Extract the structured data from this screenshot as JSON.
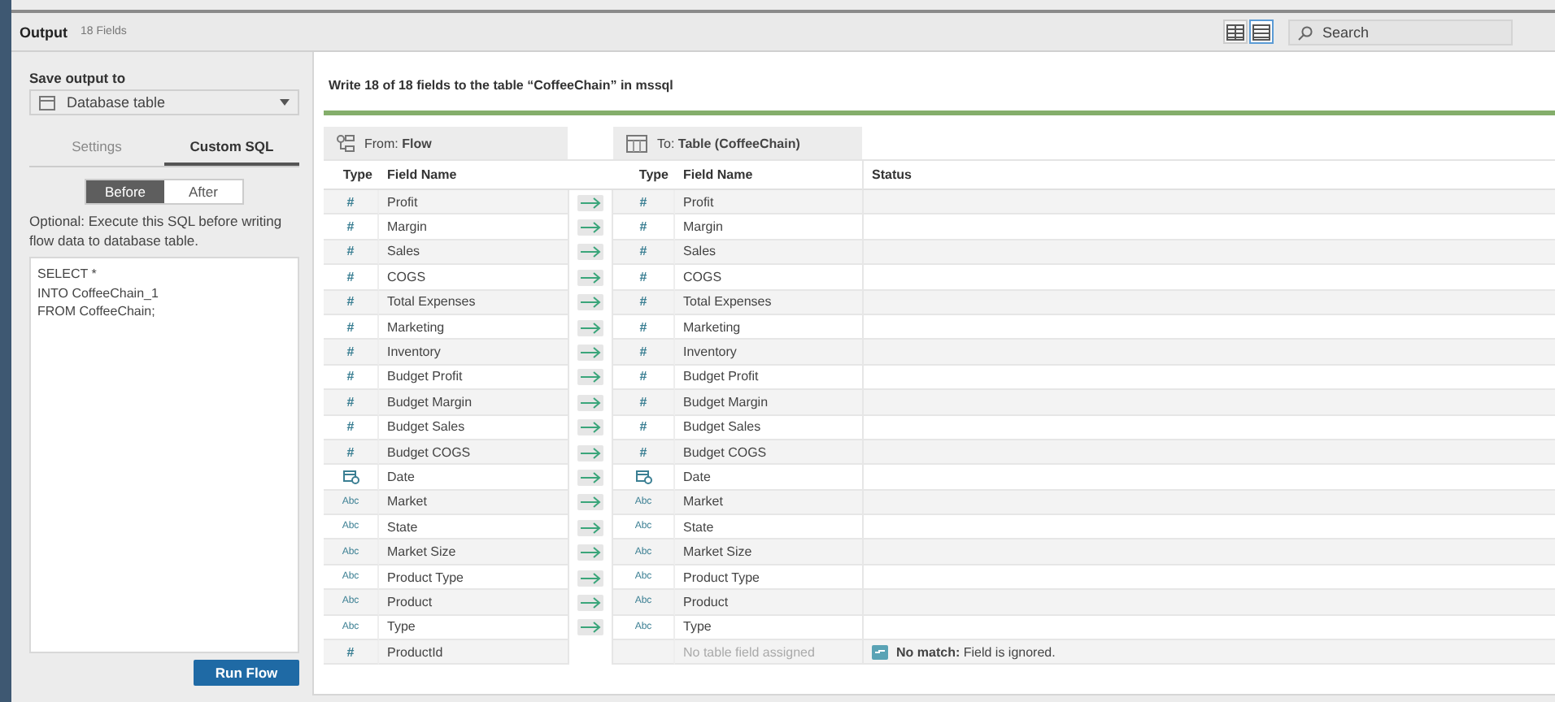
{
  "header": {
    "title": "Output",
    "subtitle": "18 Fields",
    "view_buttons": [
      {
        "selected": false
      },
      {
        "selected": true
      }
    ],
    "search": {
      "placeholder": "Search"
    }
  },
  "sidebar": {
    "save_label": "Save output to",
    "output_type": "Database table",
    "tabs": [
      {
        "label": "Settings",
        "selected": false
      },
      {
        "label": "Custom SQL",
        "selected": true
      }
    ],
    "segments": [
      {
        "label": "Before",
        "selected": true
      },
      {
        "label": "After",
        "selected": false
      }
    ],
    "hint": "Optional: Execute this SQL before writing flow data to database table.",
    "sql": [
      "SELECT *",
      "INTO CoffeeChain_1",
      "FROM CoffeeChain;"
    ],
    "run_button": "Run Flow"
  },
  "main": {
    "summary": "Write 18 of 18 fields to the table “CoffeeChain” in mssql",
    "progress": {
      "level": 1
    },
    "from_header": "From: **Flow**",
    "to_header": "To: **Table (CoffeeChain)**",
    "from_columns": [
      "Type",
      "Field Name"
    ],
    "to_columns": [
      "Type",
      "Field Name"
    ],
    "status_column": "Status",
    "rows": [
      {
        "kind": "number",
        "type_label": "#",
        "from_name": "Profit",
        "matched": true,
        "to_name": "Profit"
      },
      {
        "kind": "number",
        "type_label": "#",
        "from_name": "Margin",
        "matched": true,
        "to_name": "Margin"
      },
      {
        "kind": "number",
        "type_label": "#",
        "from_name": "Sales",
        "matched": true,
        "to_name": "Sales"
      },
      {
        "kind": "number",
        "type_label": "#",
        "from_name": "COGS",
        "matched": true,
        "to_name": "COGS"
      },
      {
        "kind": "number",
        "type_label": "#",
        "from_name": "Total Expenses",
        "matched": true,
        "to_name": "Total Expenses"
      },
      {
        "kind": "number",
        "type_label": "#",
        "from_name": "Marketing",
        "matched": true,
        "to_name": "Marketing"
      },
      {
        "kind": "number",
        "type_label": "#",
        "from_name": "Inventory",
        "matched": true,
        "to_name": "Inventory"
      },
      {
        "kind": "number",
        "type_label": "#",
        "from_name": "Budget Profit",
        "matched": true,
        "to_name": "Budget Profit"
      },
      {
        "kind": "number",
        "type_label": "#",
        "from_name": "Budget Margin",
        "matched": true,
        "to_name": "Budget Margin"
      },
      {
        "kind": "number",
        "type_label": "#",
        "from_name": "Budget Sales",
        "matched": true,
        "to_name": "Budget Sales"
      },
      {
        "kind": "number",
        "type_label": "#",
        "from_name": "Budget COGS",
        "matched": true,
        "to_name": "Budget COGS"
      },
      {
        "kind": "date",
        "from_name": "Date",
        "matched": true,
        "to_name": "Date"
      },
      {
        "kind": "string",
        "type_label": "Abc",
        "from_name": "Market",
        "matched": true,
        "to_type_label": "Abc",
        "to_name": "Market"
      },
      {
        "kind": "string",
        "type_label": "Abc",
        "from_name": "State",
        "matched": true,
        "to_type_label": "Abc",
        "to_name": "State"
      },
      {
        "kind": "string",
        "type_label": "Abc",
        "from_name": "Market Size",
        "matched": true,
        "to_type_label": "Abc",
        "to_name": "Market Size"
      },
      {
        "kind": "string",
        "type_label": "Abc",
        "from_name": "Product Type",
        "matched": true,
        "to_type_label": "Abc",
        "to_name": "Product Type"
      },
      {
        "kind": "string",
        "type_label": "Abc",
        "from_name": "Product",
        "matched": true,
        "to_type_label": "Abc",
        "to_name": "Product"
      },
      {
        "kind": "string",
        "type_label": "Abc",
        "from_name": "Type",
        "matched": true,
        "to_type_label": "Abc",
        "to_name": "Type"
      },
      {
        "kind": "number",
        "type_label": "#",
        "from_name": "ProductId",
        "matched": false,
        "to_note": "No table field assigned",
        "status": "**No match:** Field is ignored."
      }
    ]
  }
}
